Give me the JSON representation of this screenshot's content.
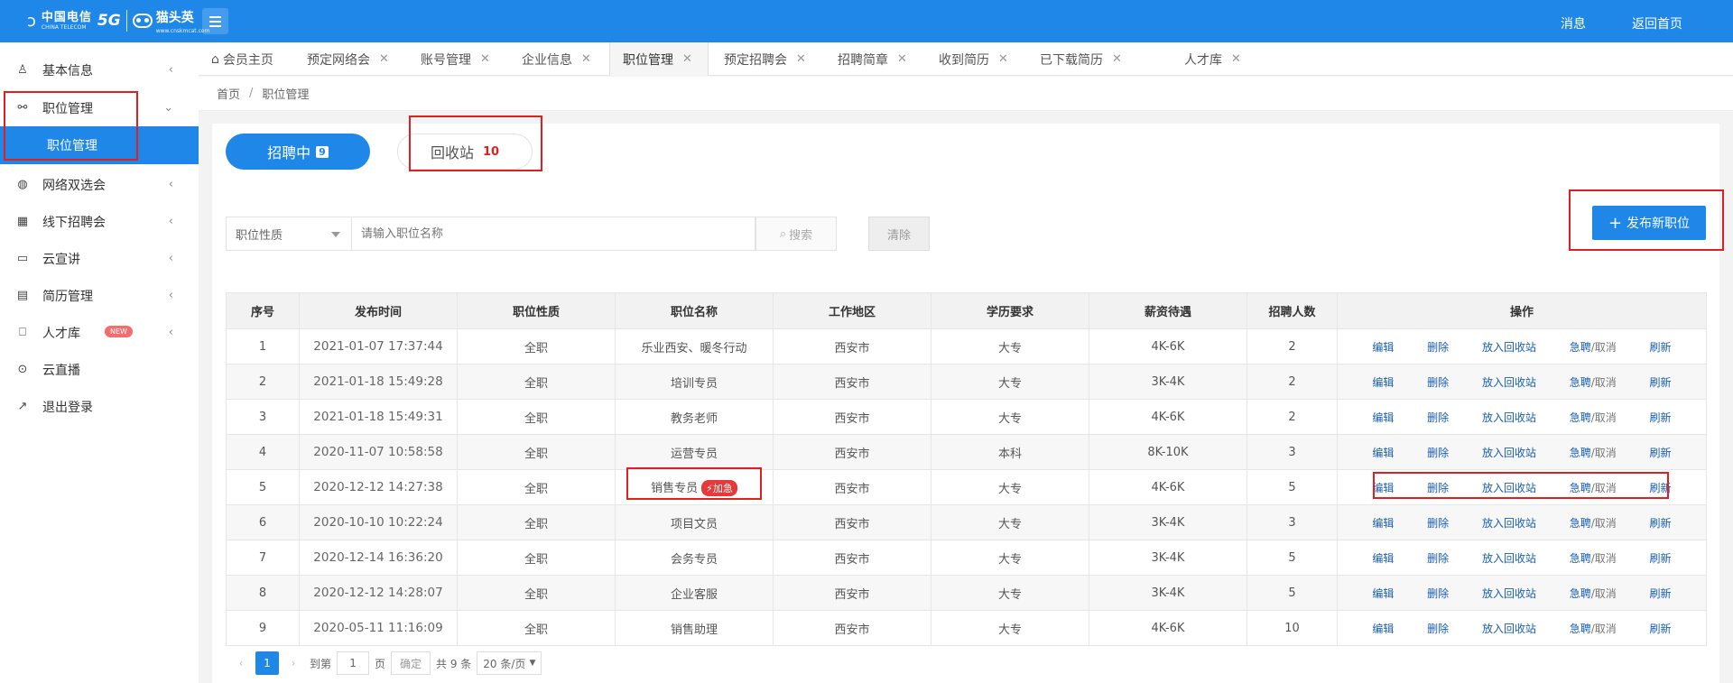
{
  "topbar": {
    "logo_cn": "中国电信",
    "logo_en": "CHINA TELECOM",
    "logo_5g": "5G",
    "brand_name": "猫头英",
    "brand_sub": "www.cnskmcat.com",
    "messages": "消息",
    "back_home": "返回首页"
  },
  "sidebar": {
    "items": [
      {
        "label": "基本信息"
      },
      {
        "label": "职位管理"
      },
      {
        "label": "网络双选会"
      },
      {
        "label": "线下招聘会"
      },
      {
        "label": "云宣讲"
      },
      {
        "label": "简历管理"
      },
      {
        "label": "人才库",
        "badge": "NEW"
      },
      {
        "label": "云直播"
      },
      {
        "label": "退出登录"
      }
    ],
    "sub_item": "职位管理"
  },
  "tabs": [
    "会员主页",
    "预定网络会",
    "账号管理",
    "企业信息",
    "职位管理",
    "预定招聘会",
    "招聘简章",
    "收到简历",
    "已下载简历",
    "人才库"
  ],
  "breadcrumb": {
    "home": "首页",
    "sep": "/",
    "current": "职位管理"
  },
  "status_tabs": {
    "recruiting_label": "招聘中",
    "recruiting_count": "9",
    "recycle_label": "回收站",
    "recycle_count": "10"
  },
  "filters": {
    "type_select": "职位性质",
    "name_placeholder": "请输入职位名称",
    "search": "搜索",
    "clear": "清除",
    "publish": "发布新职位"
  },
  "table": {
    "headers": [
      "序号",
      "发布时间",
      "职位性质",
      "职位名称",
      "工作地区",
      "学历要求",
      "薪资待遇",
      "招聘人数",
      "操作"
    ],
    "actions": {
      "edit": "编辑",
      "delete": "删除",
      "recycle": "放入回收站",
      "urgent": "急聘",
      "cancel": "/取消",
      "refresh": "刷新"
    },
    "urgent_badge": "加急",
    "rows": [
      {
        "no": "1",
        "time": "2021-01-07 17:37:44",
        "type": "全职",
        "name": "乐业西安、暖冬行动",
        "area": "西安市",
        "edu": "大专",
        "salary": "4K-6K",
        "count": "2"
      },
      {
        "no": "2",
        "time": "2021-01-18 15:49:28",
        "type": "全职",
        "name": "培训专员",
        "area": "西安市",
        "edu": "大专",
        "salary": "3K-4K",
        "count": "2"
      },
      {
        "no": "3",
        "time": "2021-01-18 15:49:31",
        "type": "全职",
        "name": "教务老师",
        "area": "西安市",
        "edu": "大专",
        "salary": "4K-6K",
        "count": "2"
      },
      {
        "no": "4",
        "time": "2020-11-07 10:58:58",
        "type": "全职",
        "name": "运营专员",
        "area": "西安市",
        "edu": "本科",
        "salary": "8K-10K",
        "count": "3"
      },
      {
        "no": "5",
        "time": "2020-12-12 14:27:38",
        "type": "全职",
        "name": "销售专员",
        "area": "西安市",
        "edu": "大专",
        "salary": "4K-6K",
        "count": "5"
      },
      {
        "no": "6",
        "time": "2020-10-10 10:22:24",
        "type": "全职",
        "name": "项目文员",
        "area": "西安市",
        "edu": "大专",
        "salary": "3K-4K",
        "count": "3"
      },
      {
        "no": "7",
        "time": "2020-12-14 16:36:20",
        "type": "全职",
        "name": "会务专员",
        "area": "西安市",
        "edu": "大专",
        "salary": "3K-4K",
        "count": "5"
      },
      {
        "no": "8",
        "time": "2020-12-12 14:28:07",
        "type": "全职",
        "name": "企业客服",
        "area": "西安市",
        "edu": "大专",
        "salary": "3K-4K",
        "count": "5"
      },
      {
        "no": "9",
        "time": "2020-05-11 11:16:09",
        "type": "全职",
        "name": "销售助理",
        "area": "西安市",
        "edu": "大专",
        "salary": "4K-6K",
        "count": "10"
      }
    ]
  },
  "pager": {
    "current": "1",
    "goto": "到第",
    "page_input": "1",
    "page_unit": "页",
    "confirm": "确定",
    "total": "共 9 条",
    "per_page": "20 条/页"
  }
}
